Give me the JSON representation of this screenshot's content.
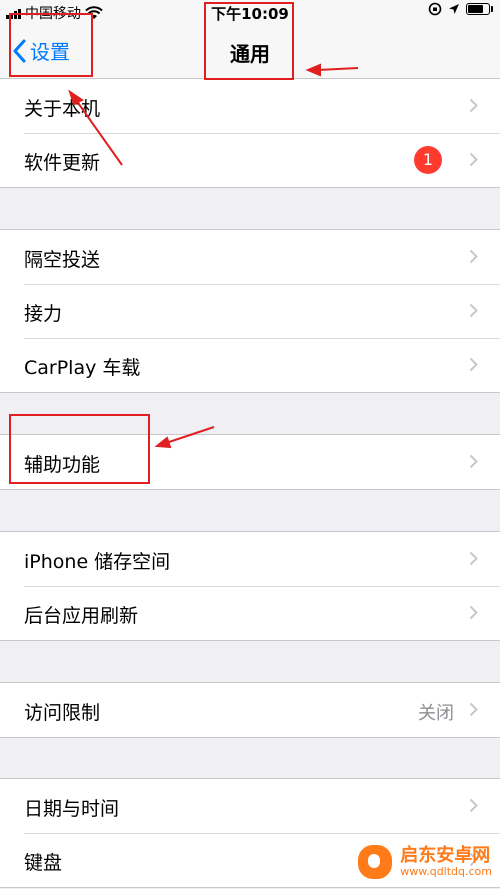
{
  "status_bar": {
    "carrier": "中国移动",
    "time": "下午10:09",
    "battery_level": 0.85
  },
  "nav": {
    "back_label": "设置",
    "title": "通用"
  },
  "groups": [
    {
      "rows": [
        {
          "label": "关于本机"
        },
        {
          "label": "软件更新",
          "badge": "1"
        }
      ]
    },
    {
      "rows": [
        {
          "label": "隔空投送"
        },
        {
          "label": "接力"
        },
        {
          "label": "CarPlay 车载"
        }
      ]
    },
    {
      "rows": [
        {
          "label": "辅助功能"
        }
      ]
    },
    {
      "rows": [
        {
          "label": "iPhone 储存空间"
        },
        {
          "label": "后台应用刷新"
        }
      ]
    },
    {
      "rows": [
        {
          "label": "访问限制",
          "detail": "关闭"
        }
      ]
    },
    {
      "rows": [
        {
          "label": "日期与时间"
        },
        {
          "label": "键盘"
        }
      ]
    }
  ],
  "watermark": {
    "title": "启东安卓网",
    "url": "www.qdltdq.com"
  },
  "colors": {
    "accent": "#007aff",
    "badge": "#ff3b30",
    "annotation": "#e02020",
    "background": "#efeff4"
  }
}
